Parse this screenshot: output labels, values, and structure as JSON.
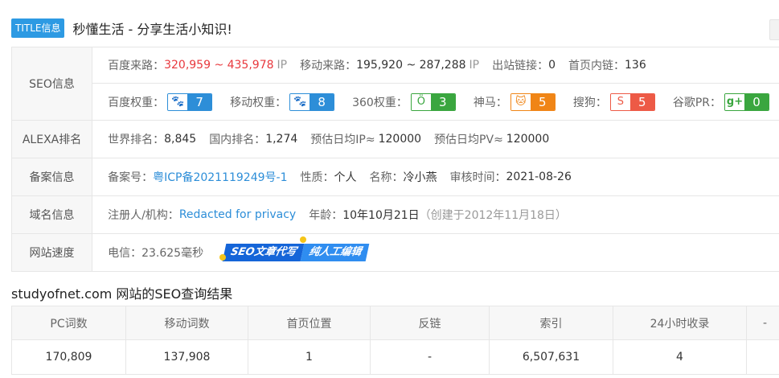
{
  "title": {
    "tag": "TITLE信息",
    "text": "秒懂生活 - 分享生活小知识!"
  },
  "seo": {
    "label": "SEO信息",
    "baidu_traffic": {
      "label": "百度来路：",
      "value": "320,959 ~ 435,978",
      "unit": "IP"
    },
    "mobile_traffic": {
      "label": "移动来路：",
      "value": "195,920 ~ 287,288",
      "unit": "IP"
    },
    "outlinks": {
      "label": "出站链接：",
      "value": "0"
    },
    "home_links": {
      "label": "首页内链：",
      "value": "136"
    },
    "weights": [
      {
        "label": "百度权重：",
        "icon": "paw-icon",
        "glyph": "🐾",
        "value": "7",
        "color": "#2d8ed8"
      },
      {
        "label": "移动权重：",
        "icon": "paw-icon",
        "glyph": "🐾",
        "value": "8",
        "color": "#2d8ed8"
      },
      {
        "label": "360权重：",
        "icon": "360-icon",
        "glyph": "Ö",
        "value": "3",
        "color": "#3aa63f"
      },
      {
        "label": "神马：",
        "icon": "shenma-icon",
        "glyph": "🐱",
        "value": "5",
        "color": "#f08516"
      },
      {
        "label": "搜狗：",
        "icon": "sogou-icon",
        "glyph": "S",
        "value": "5",
        "color": "#ed5a46"
      },
      {
        "label": "谷歌PR：",
        "icon": "google-plus-icon",
        "glyph": "g+",
        "value": "0",
        "color": "#3aa63f"
      }
    ]
  },
  "alexa": {
    "label": "ALEXA排名",
    "world": {
      "label": "世界排名：",
      "value": "8,845"
    },
    "domestic": {
      "label": "国内排名：",
      "value": "1,274"
    },
    "daily_ip": {
      "label": "预估日均IP≈",
      "value": "120000"
    },
    "daily_pv": {
      "label": "预估日均PV≈",
      "value": "120000"
    }
  },
  "icp": {
    "label": "备案信息",
    "number": {
      "label": "备案号：",
      "value": "粤ICP备2021119249号-1"
    },
    "nature": {
      "label": "性质：",
      "value": "个人"
    },
    "name": {
      "label": "名称：",
      "value": "冷小燕"
    },
    "review": {
      "label": "审核时间：",
      "value": "2021-08-26"
    }
  },
  "domain": {
    "label": "域名信息",
    "registrant": {
      "label": "注册人/机构：",
      "value": "Redacted for privacy"
    },
    "age": {
      "label": "年龄：",
      "value": "10年10月21日",
      "created": "（创建于2012年11月18日）"
    }
  },
  "speed": {
    "label": "网站速度",
    "telecom": "电信：23.625毫秒",
    "promo": {
      "part1": "SEO文章代写",
      "part2": "纯人工编辑"
    }
  },
  "results": {
    "title": "studyofnet.com 网站的SEO查询结果",
    "columns": [
      "PC词数",
      "移动词数",
      "首页位置",
      "反链",
      "索引",
      "24小时收录",
      "-"
    ],
    "row": [
      "170,809",
      "137,908",
      "1",
      "-",
      "6,507,631",
      "4",
      ""
    ]
  }
}
